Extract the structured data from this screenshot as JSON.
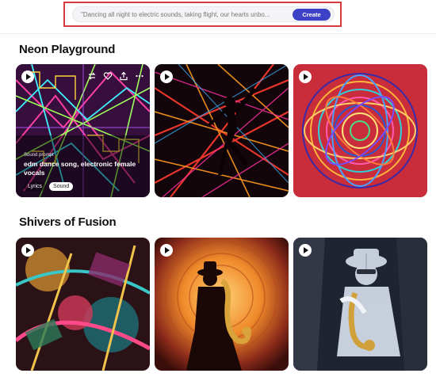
{
  "search": {
    "placeholder": "\"Dancing all night to electric sounds, taking flight, our hearts unbo...",
    "create_label": "Create"
  },
  "sections": [
    {
      "title": "Neon Playground",
      "cards": [
        {
          "art": "neon-line-grid",
          "hovered": true,
          "prompt_label": "Sound prompt",
          "prompt_text": "edm dance song, electronic female vocals",
          "chip_lyrics": "Lyrics",
          "chip_sound": "Sound"
        },
        {
          "art": "neon-dancer-silhouette"
        },
        {
          "art": "neon-swirl-mandala"
        }
      ]
    },
    {
      "title": "Shivers of Fusion",
      "cards": [
        {
          "art": "abstract-music-collage"
        },
        {
          "art": "saxophone-player-silhouette-orange"
        },
        {
          "art": "saxophone-player-glass-sculpture"
        }
      ]
    }
  ],
  "colors": {
    "accent": "#3d41c6",
    "highlight_border": "#d63a3a"
  },
  "icons": [
    "play-icon",
    "remix-icon",
    "heart-icon",
    "share-icon",
    "more-icon"
  ]
}
